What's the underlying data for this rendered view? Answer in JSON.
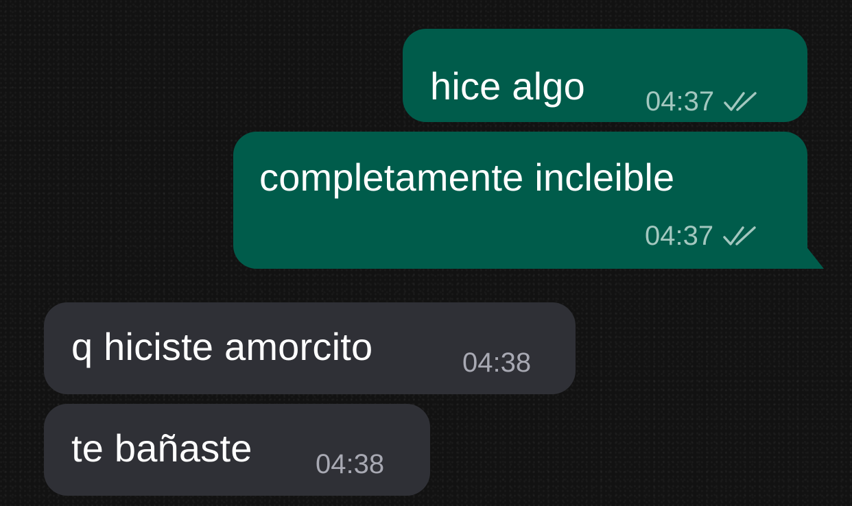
{
  "messages": [
    {
      "direction": "outgoing",
      "text": "hice algo",
      "time": "04:37",
      "status_icon": "double-check-icon"
    },
    {
      "direction": "outgoing",
      "text": "completamente incleible",
      "time": "04:37",
      "status_icon": "double-check-icon"
    },
    {
      "direction": "incoming",
      "text": "q hiciste amorcito",
      "time": "04:38"
    },
    {
      "direction": "incoming",
      "text": "te bañaste",
      "time": "04:38"
    }
  ],
  "colors": {
    "background": "#121212",
    "outgoing_bubble": "#005c4b",
    "incoming_bubble": "#2f3036",
    "outgoing_meta": "#a3c7bf",
    "incoming_meta": "#a8a9b3",
    "text": "#ffffff"
  }
}
